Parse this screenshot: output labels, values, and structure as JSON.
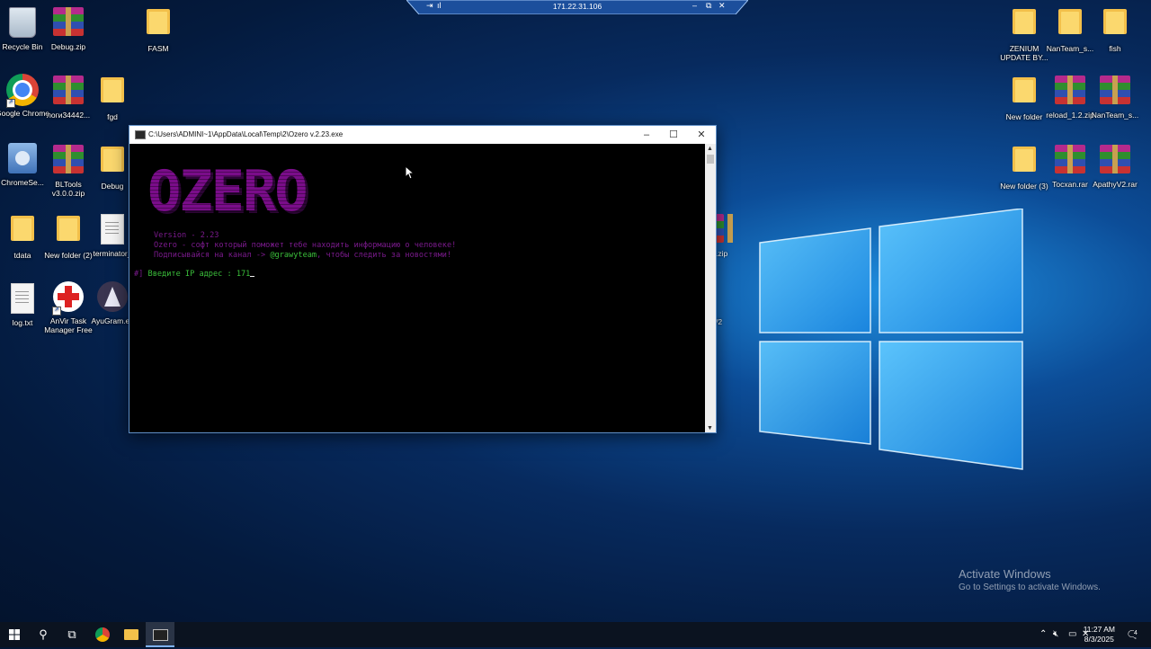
{
  "remote_bar": {
    "ip": "171.22.31.106"
  },
  "desktop_icons": [
    {
      "label": "Recycle Bin"
    },
    {
      "label": "Debug.zip"
    },
    {
      "label": "FASM"
    },
    {
      "label": "Google Chrome"
    },
    {
      "label": "логи34442..."
    },
    {
      "label": "fgd"
    },
    {
      "label": "ChromeSe..."
    },
    {
      "label": "BLTools v3.0.0.zip"
    },
    {
      "label": "Debug"
    },
    {
      "label": "tdata"
    },
    {
      "label": "New folder (2)"
    },
    {
      "label": "terminator_"
    },
    {
      "label": "log.txt"
    },
    {
      "label": "AnVir Task Manager Free"
    },
    {
      "label": "AyuGram.ex"
    },
    {
      "label": "ZENIUM UPDATE BY..."
    },
    {
      "label": "NanTeam_s..."
    },
    {
      "label": "fish"
    },
    {
      "label": "New folder"
    },
    {
      "label": "reload_1.2.zip"
    },
    {
      "label": "NanTeam_s..."
    },
    {
      "label": "New folder (3)"
    },
    {
      "label": "Tocxan.rar"
    },
    {
      "label": "ApathyV2.rar"
    }
  ],
  "peek_labels": [
    ".zip",
    "/2"
  ],
  "console": {
    "title": "C:\\Users\\ADMINI~1\\AppData\\Local\\Temp\\2\\Ozero v.2.23.exe",
    "logo": "OZERO",
    "version_line": "Version - 2.23",
    "desc_line": "Ozero - софт который поможет тебе находить информацию о человеке!",
    "sub_prefix": "Подписывайся на канал -> ",
    "sub_handle": "@grawyteam",
    "sub_suffix": ", чтобы следить за новостями!",
    "prompt_mark": "#]",
    "prompt_text": " Введите IP адрес : 171"
  },
  "activate": {
    "title": "Activate Windows",
    "subtitle": "Go to Settings to activate Windows."
  },
  "taskbar": {
    "time": "11:27 AM",
    "date": "8/3/2025",
    "notif_count": "4"
  }
}
